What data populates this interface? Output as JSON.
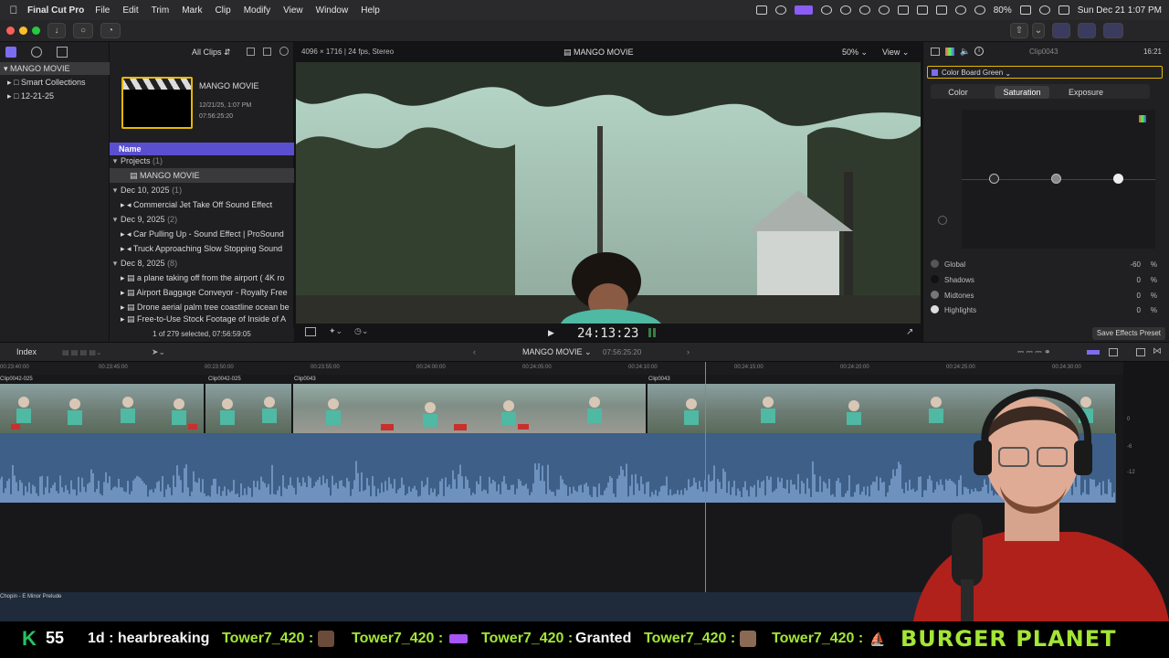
{
  "menubar": {
    "app": "Final Cut Pro",
    "menus": [
      "File",
      "Edit",
      "Trim",
      "Mark",
      "Clip",
      "Modify",
      "View",
      "Window",
      "Help"
    ],
    "battery": "80%",
    "datetime": "Sun Dec 21  1:07 PM"
  },
  "library": {
    "name": "MANGO MOVIE",
    "items": [
      "Smart Collections",
      "12-21-25"
    ]
  },
  "browser": {
    "filter": "All Clips",
    "project": {
      "title": "MANGO MOVIE",
      "date": "12/21/25, 1:07 PM",
      "duration": "07:56:25:20"
    },
    "column_header": "Name",
    "groups": [
      {
        "label": "Projects",
        "count": "(1)",
        "items": [
          "MANGO MOVIE"
        ]
      },
      {
        "label": "Dec 10, 2025",
        "count": "(1)",
        "items": [
          "Commercial Jet Take Off Sound Effect"
        ]
      },
      {
        "label": "Dec 9, 2025",
        "count": "(2)",
        "items": [
          "Car Pulling Up - Sound Effect  |  ProSound",
          "Truck Approaching Slow Stopping Sound"
        ]
      },
      {
        "label": "Dec 8, 2025",
        "count": "(8)",
        "items": [
          "a plane taking off from the airport ( 4K ro",
          "Airport Baggage Conveyor - Royalty Free",
          "Drone aerial palm tree coastline ocean be",
          "Free-to-Use Stock Footage of Inside of A"
        ]
      }
    ],
    "status": "1 of 279 selected, 07:56:59:05"
  },
  "viewer": {
    "format": "4096 × 1716 | 24 fps, Stereo",
    "title": "MANGO MOVIE",
    "zoom": "50%",
    "view": "View",
    "timecode": "24:13:23"
  },
  "inspector": {
    "clip": "Clip0043",
    "duration": "16:21",
    "effect": "Color Board Green",
    "tabs": [
      "Color",
      "Saturation",
      "Exposure"
    ],
    "active_tab": "Saturation",
    "params": [
      {
        "label": "Global",
        "value": "-60",
        "unit": "%"
      },
      {
        "label": "Shadows",
        "value": "0",
        "unit": "%"
      },
      {
        "label": "Midtones",
        "value": "0",
        "unit": "%"
      },
      {
        "label": "Highlights",
        "value": "0",
        "unit": "%"
      }
    ],
    "save_preset": "Save Effects Preset"
  },
  "timeline": {
    "index": "Index",
    "project": "MANGO MOVIE",
    "position": "07:56:25:20",
    "ruler": [
      "00:23:40:00",
      "00:23:45:00",
      "00:23:50:00",
      "00:23:55:00",
      "00:24:00:00",
      "00:24:05:00",
      "00:24:10:00",
      "00:24:15:00",
      "00:24:20:00",
      "00:24:25:00",
      "00:24:30:00"
    ],
    "clips": [
      "Clip0042-025",
      "Clip0042-025",
      "Clip0043",
      "Clip0043"
    ],
    "music": "Chopin - E Minor Prelude",
    "meter_labels": [
      "0",
      "-6",
      "-12"
    ]
  },
  "stream": {
    "counter_letter": "K",
    "counter_value": "55",
    "chat": [
      {
        "user": "",
        "msg": "1d : hearbreaking"
      },
      {
        "user": "Tower7_420 :",
        "msg": ""
      },
      {
        "user": "Tower7_420 :",
        "msg": ""
      },
      {
        "user": "Tower7_420 :",
        "msg": "Granted"
      },
      {
        "user": "Tower7_420 :",
        "msg": ""
      },
      {
        "user": "Tower7_420 :",
        "msg": ""
      }
    ],
    "banner": "BURGER PLANET"
  }
}
